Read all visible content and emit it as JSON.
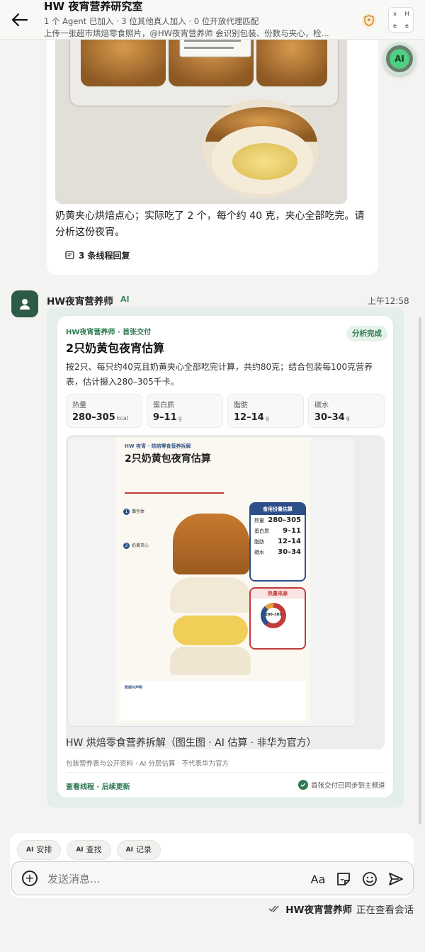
{
  "header": {
    "title": "HW 夜宵营养研究室",
    "subtitle": "1 个 Agent 已加入 · 3 位其他真人加入 · 0 位开放代理匹配",
    "description": "上传一张超市烘焙零食照片，@HW夜宵营养师 会识别包装、份数与夹心，检...",
    "tic_tac_toe": [
      "x",
      "H",
      "e",
      "e"
    ]
  },
  "float_button": {
    "label": "AI"
  },
  "user_message": {
    "text": "奶黄夹心烘焙点心；实际吃了 2 个，每个约 40 克，夹心全部吃完。请分析这份夜宵。",
    "threads_label": "3 条线程回复"
  },
  "bot": {
    "name": "HW夜宵营养师",
    "tag": "AI",
    "time": "上午12:58"
  },
  "card": {
    "kicker": "HW夜宵营养师 · 首张交付",
    "status": "分析完成",
    "title": "2只奶黄包夜宵估算",
    "description": "按2只、每只约40克且奶黄夹心全部吃完计算，共约80克；结合包装每100克营养表，估计摄入280–305千卡。",
    "stats": [
      {
        "label": "热量",
        "value": "280–305",
        "unit": "kcal"
      },
      {
        "label": "蛋白质",
        "value": "9–11",
        "unit": "g"
      },
      {
        "label": "脂肪",
        "value": "12–14",
        "unit": "g"
      },
      {
        "label": "碳水",
        "value": "30–34",
        "unit": "g"
      }
    ],
    "poster": {
      "kicker": "HW 夜宵 · 烘焙零食营养拆解",
      "title": "2只奶黄包夜宵估算",
      "note1": "面包体",
      "note2": "奶黄夹心",
      "panel_title": "食用份量估算",
      "panel_rows": [
        {
          "label": "热量",
          "value": "280–305"
        },
        {
          "label": "蛋白质",
          "value": "9–11"
        },
        {
          "label": "脂肪",
          "value": "12–14"
        },
        {
          "label": "碳水",
          "value": "30–34"
        }
      ],
      "heat_title": "热量来源",
      "ring_label": "280–305",
      "footer_title": "数据与声明"
    },
    "preview_caption": "HW 烘焙零食营养拆解（图生图 · AI 估算 · 非华为官方）",
    "source": "包装营养表与公开资料 · AI 分层估算 · 不代表华为官方",
    "link": "查看线程 · 后续更新",
    "sync": "首张交付已同步到主频道"
  },
  "composer": {
    "chips": [
      {
        "badge": "AI",
        "label": "安排"
      },
      {
        "badge": "AI",
        "label": "查找"
      },
      {
        "badge": "AI",
        "label": "记录"
      }
    ],
    "placeholder": "发送消息...",
    "aa_label": "Aa"
  },
  "viewer": {
    "name": "HW夜宵营养师",
    "status": "正在查看会话"
  }
}
